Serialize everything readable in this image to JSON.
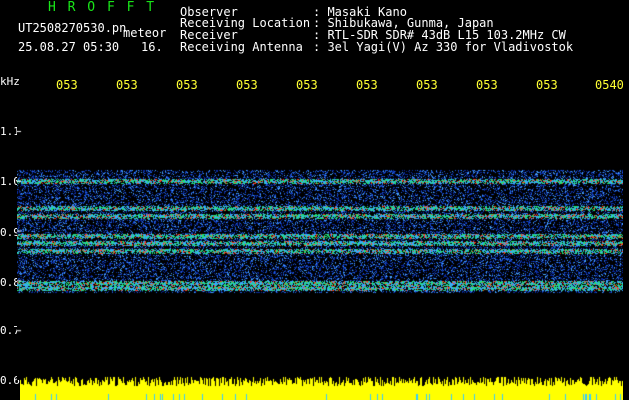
{
  "header": {
    "app_title": "H R O F F T",
    "filename": "UT2508270530.pn",
    "mode": "meteor",
    "datetime": "25.08.27 05:30",
    "count": "16.",
    "fields": [
      {
        "label": "Observer",
        "value": ": Masaki Kano"
      },
      {
        "label": "Receiving Location",
        "value": ": Shibukawa, Gunma, Japan"
      },
      {
        "label": "Receiver",
        "value": ": RTL-SDR SDR# 43dB L15 103.2MHz CW"
      },
      {
        "label": "Receiving Antenna",
        "value": ": 3el Yagi(V) Az 330 for Vladivostok"
      }
    ]
  },
  "axis": {
    "y_unit": "kHz",
    "y_ticks": [
      "1.1",
      "1.0",
      "0.9",
      "0.8",
      "0.7",
      "0.6"
    ],
    "x_ticks": [
      "053",
      "053",
      "053",
      "053",
      "053",
      "053",
      "053",
      "053",
      "053",
      "0540"
    ]
  },
  "colors": {
    "background": "#000000",
    "title": "#19e619",
    "text": "#ffffff",
    "tick": "#ffff33",
    "signal_strong": "#ff3b1a",
    "signal_mid": "#22e07a",
    "noise": "#0a2aa0"
  },
  "signal": {
    "band_top_khz": 1.02,
    "band_bottom_khz": 0.775,
    "lines_khz": [
      1.0,
      0.945,
      0.93,
      0.89,
      0.875,
      0.86,
      0.795,
      0.785
    ]
  }
}
